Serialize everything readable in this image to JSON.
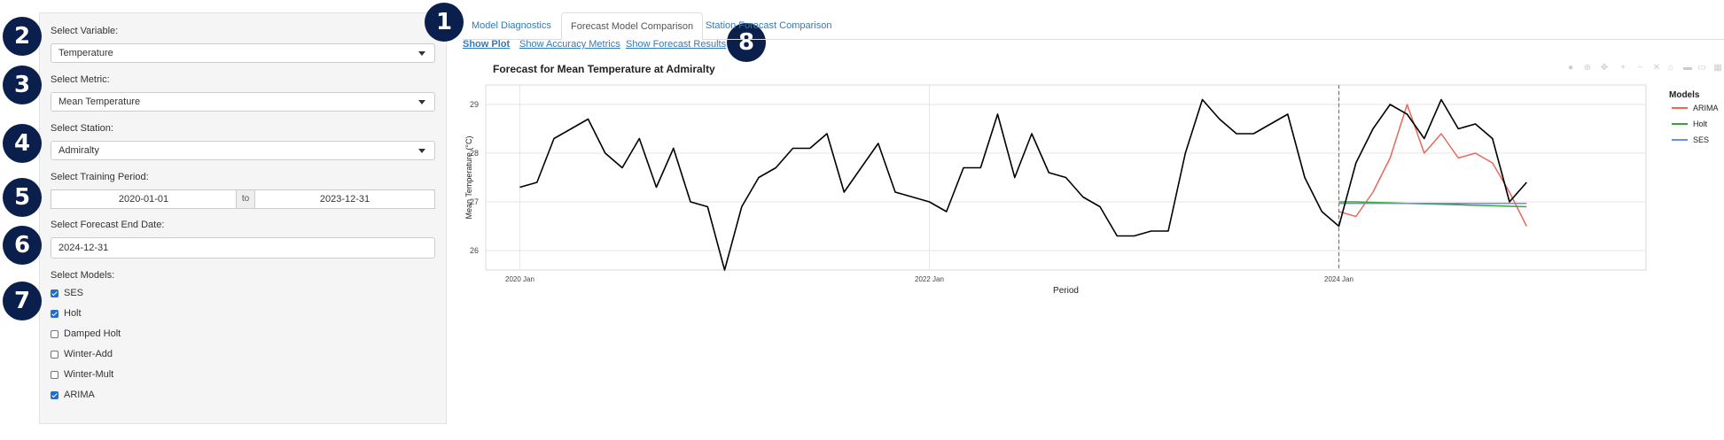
{
  "sidebar": {
    "variable": {
      "label": "Select Variable:",
      "value": "Temperature"
    },
    "metric": {
      "label": "Select Metric:",
      "value": "Mean Temperature"
    },
    "station": {
      "label": "Select Station:",
      "value": "Admiralty"
    },
    "training": {
      "label": "Select Training Period:",
      "start": "2020-01-01",
      "sep": "to",
      "end": "2023-12-31"
    },
    "forecast_end": {
      "label": "Select Forecast End Date:",
      "value": "2024-12-31"
    },
    "models": {
      "label": "Select Models:",
      "items": [
        {
          "label": "SES",
          "checked": true
        },
        {
          "label": "Holt",
          "checked": true
        },
        {
          "label": "Damped Holt",
          "checked": false
        },
        {
          "label": "Winter-Add",
          "checked": false
        },
        {
          "label": "Winter-Mult",
          "checked": false
        },
        {
          "label": "ARIMA",
          "checked": true
        }
      ]
    }
  },
  "badges": [
    "1",
    "2",
    "3",
    "4",
    "5",
    "6",
    "7",
    "8"
  ],
  "tabs": [
    {
      "label": "Model Diagnostics",
      "active": false
    },
    {
      "label": "Forecast Model Comparison",
      "active": true
    },
    {
      "label": "Station Forecast Comparison",
      "active": false
    }
  ],
  "subtabs": [
    {
      "label": "Show Plot",
      "active": true
    },
    {
      "label": "Show Accuracy Metrics",
      "active": false
    },
    {
      "label": "Show Forecast Results",
      "active": false
    }
  ],
  "chart_data": {
    "type": "line",
    "title": "Forecast for Mean Temperature at Admiralty",
    "xlabel": "Period",
    "ylabel": "Mean Temperature (°C)",
    "ylim": [
      25.6,
      29.4
    ],
    "yticks": [
      26,
      27,
      28,
      29
    ],
    "xticks": [
      {
        "label": "2020 Jan",
        "month": 0
      },
      {
        "label": "2022 Jan",
        "month": 24
      },
      {
        "label": "2024 Jan",
        "month": 48
      }
    ],
    "forecast_start_month": 48,
    "legend_title": "Models",
    "legend_position": "right",
    "actual": {
      "color": "#000000",
      "values": [
        27.3,
        27.4,
        28.3,
        28.5,
        28.7,
        28.0,
        27.7,
        28.3,
        27.3,
        28.1,
        27.0,
        26.9,
        25.6,
        26.9,
        27.5,
        27.7,
        28.1,
        28.1,
        28.4,
        27.2,
        27.7,
        28.2,
        27.2,
        27.1,
        27.0,
        26.8,
        27.7,
        27.7,
        28.8,
        27.5,
        28.4,
        27.6,
        27.5,
        27.1,
        26.9,
        26.3,
        26.3,
        26.4,
        26.4,
        28.0,
        29.1,
        28.7,
        28.4,
        28.4,
        28.6,
        28.8,
        27.5,
        26.8,
        26.5,
        27.8,
        28.5,
        29.0,
        28.8,
        28.3,
        29.1,
        28.5,
        28.6,
        28.3,
        27.0,
        27.4
      ]
    },
    "series": [
      {
        "name": "ARIMA",
        "color": "#e8685a",
        "x0": 48,
        "values": [
          26.8,
          26.7,
          27.2,
          27.9,
          29.0,
          28.0,
          28.4,
          27.9,
          28.0,
          27.8,
          27.2,
          26.5
        ]
      },
      {
        "name": "Holt",
        "color": "#3aa33a",
        "x0": 48,
        "values": [
          27.0,
          27.0,
          26.99,
          26.98,
          26.97,
          26.96,
          26.95,
          26.94,
          26.93,
          26.92,
          26.91,
          26.9
        ]
      },
      {
        "name": "SES",
        "color": "#6b8ee6",
        "x0": 48,
        "values": [
          26.97,
          26.97,
          26.97,
          26.97,
          26.97,
          26.97,
          26.97,
          26.97,
          26.97,
          26.97,
          26.97,
          26.97
        ]
      }
    ],
    "grid": true
  }
}
